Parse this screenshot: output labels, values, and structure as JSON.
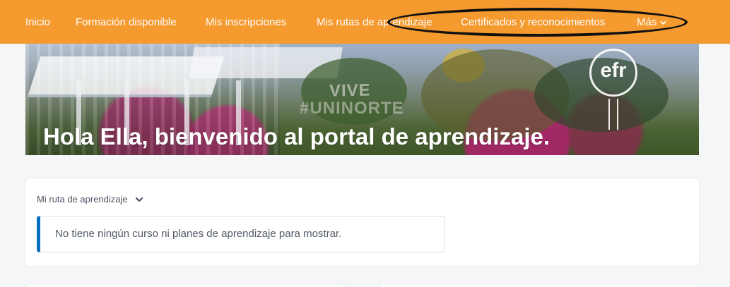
{
  "colors": {
    "nav_background": "#f59a2f",
    "page_background": "#f5f6f8",
    "card_background": "#ffffff",
    "message_accent": "#006fbf",
    "highlight_ring": "#111111"
  },
  "nav": {
    "items": [
      {
        "label": "Inicio"
      },
      {
        "label": "Formación disponible"
      },
      {
        "label": "Mis inscripciones"
      },
      {
        "label": "Mis rutas de aprendizaje"
      },
      {
        "label": "Certificados y reconocimientos"
      },
      {
        "label": "Más"
      }
    ],
    "more_icon": "chevron-down-icon"
  },
  "banner": {
    "greeting": "Hola Ella, bienvenido al portal de aprendizaje.",
    "logo_text": "efr",
    "campus_text_line1": "VIVE",
    "campus_text_line2": "#UNINORTE"
  },
  "learning_path": {
    "title": "Mi ruta de aprendizaje",
    "dropdown_icon": "chevron-down-icon",
    "empty_message": "No tiene ningún curso ni planes de aprendizaje para mostrar."
  }
}
